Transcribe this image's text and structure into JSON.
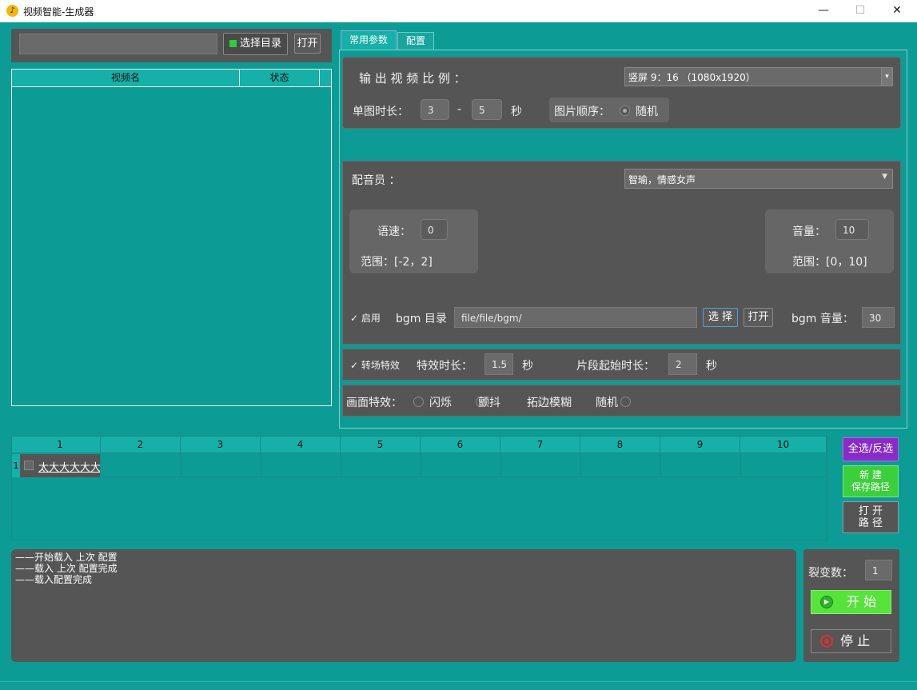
{
  "window": {
    "title": "视频智能-生成器",
    "minimize": "—",
    "maximize": "☐",
    "close": "✕"
  },
  "top_left": {
    "path_value": "",
    "select_dir_label": "选择目录",
    "open_label": "打开"
  },
  "video_table": {
    "headers": [
      "视频名",
      "状态"
    ]
  },
  "tabs": [
    {
      "label": "常用参数"
    },
    {
      "label": "配置"
    }
  ],
  "params": {
    "ratio_label": "输 出 视 频 比 例  ：",
    "ratio_value": "竖屏  9：16 （1080x1920）",
    "single_duration_label": "单图时长：",
    "single_min": "3",
    "dash": "-",
    "single_max": "5",
    "seconds": "秒",
    "order_label": "图片顺序：",
    "order_option": "随机"
  },
  "voice": {
    "dubber_label": "配音员 ：",
    "dubber_value": "智瑜，情感女声",
    "speed_label": "语速：",
    "speed_value": "0",
    "speed_range": "范围：[-2，2]",
    "volume_label": "音量：",
    "volume_value": "10",
    "volume_range": "范围：[0，10]",
    "enable_label": "启用",
    "bgm_dir_label": "bgm 目录",
    "bgm_path": "file/file/bgm/",
    "select_label": "选 择",
    "open_label": "打开",
    "bgm_volume_label": "bgm 音量：",
    "bgm_volume_value": "30"
  },
  "transition": {
    "enable_label": "转场特效",
    "effect_duration_label": "特效时长：",
    "effect_duration_value": "1.5",
    "seconds": "秒",
    "clip_start_label": "片段起始时长：",
    "clip_start_value": "2",
    "seconds2": "秒"
  },
  "effects": {
    "label": "画面特效：",
    "options": [
      "闪烁",
      "颤抖",
      "拓边模糊",
      "随机"
    ]
  },
  "grid": {
    "columns": [
      "1",
      "2",
      "3",
      "4",
      "5",
      "6",
      "7",
      "8",
      "9",
      "10"
    ],
    "row_number": "1",
    "first_cell": "太大大大大大"
  },
  "side_buttons": {
    "select_all": "全选/反选",
    "new_save_path": "新  建\n保存路径",
    "open_path": "打  开\n路  径"
  },
  "log": [
    "——开始载入 上次 配置",
    "——载入 上次 配置完成",
    "——载入配置完成"
  ],
  "run": {
    "split_label": "裂变数：",
    "split_value": "1",
    "start_label": "开  始",
    "stop_label": "停  止"
  },
  "colors": {
    "teal": "#0d9b95",
    "panel": "#555555",
    "purple": "#8a2bc8",
    "green": "#3ccf3c",
    "start_green": "#56e33a",
    "stop_red": "#e03030"
  }
}
